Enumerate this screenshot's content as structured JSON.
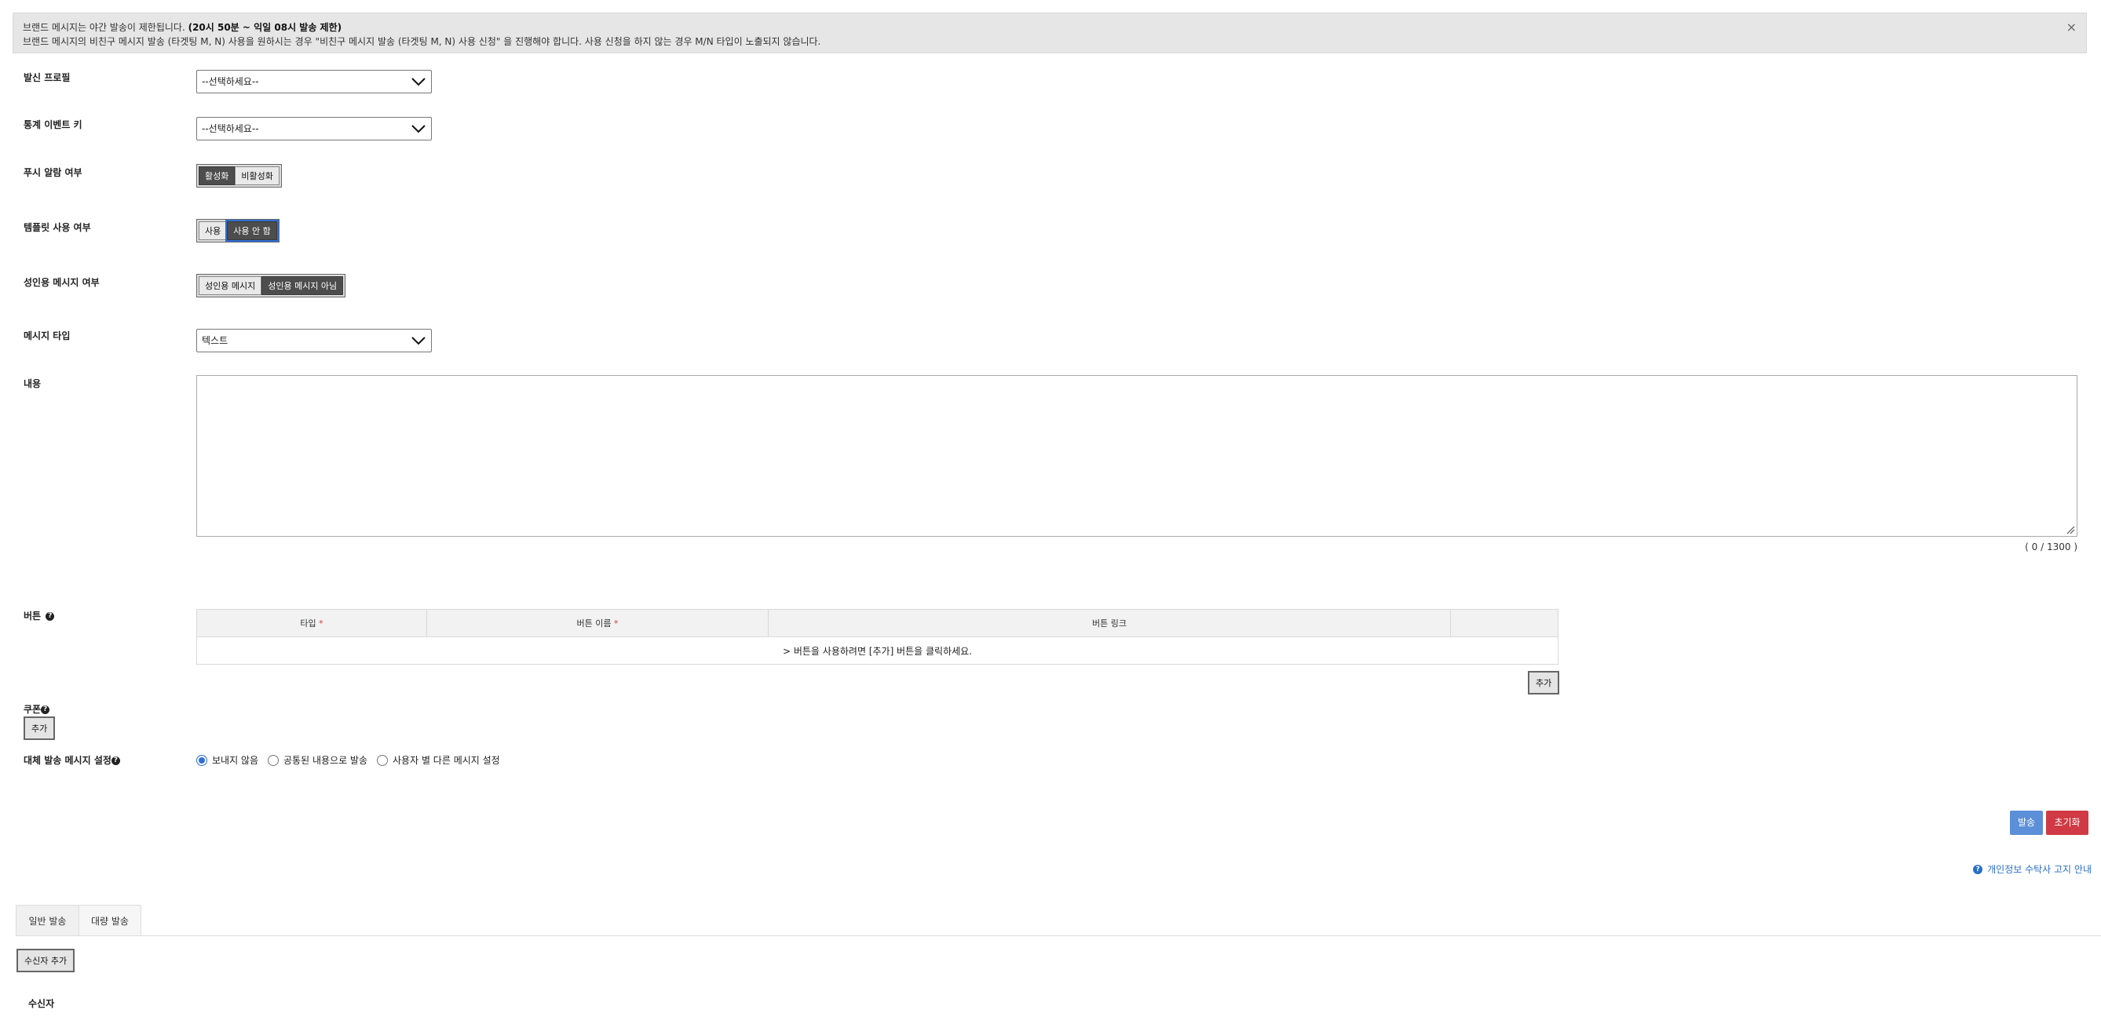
{
  "notice": {
    "line1_prefix": "브랜드 메시지는 야간 발송이 제한됩니다. ",
    "line1_bold": "(20시 50분 ~ 익일 08시 발송 제한)",
    "line2": "브랜드 메시지의 비친구 메시지 발송 (타겟팅 M, N) 사용을 원하시는 경우 \"비친구 메시지 발송 (타겟팅 M, N) 사용 신청\" 을 진행해야 합니다. 사용 신청을 하지 않는 경우 M/N 타입이 노출되지 않습니다.",
    "close": "×"
  },
  "form": {
    "sender_profile": {
      "label": "발신 프로필",
      "value": "--선택하세요--"
    },
    "stat_event_key": {
      "label": "통계 이벤트 키",
      "value": "--선택하세요--"
    },
    "push_alarm": {
      "label": "푸시 알람 여부",
      "options": [
        "활성화",
        "비활성화"
      ],
      "selected": "활성화"
    },
    "template_use": {
      "label": "템플릿 사용 여부",
      "options": [
        "사용",
        "사용 안 함"
      ],
      "selected": "사용 안 함"
    },
    "adult_message": {
      "label": "성인용 메시지 여부",
      "options": [
        "성인용 메시지",
        "성인용 메시지 아님"
      ],
      "selected": "성인용 메시지 아님"
    },
    "message_type": {
      "label": "메시지 타입",
      "value": "텍스트"
    },
    "content": {
      "label": "내용",
      "value": "",
      "counter": "( 0 / 1300 )"
    },
    "buttons": {
      "label": "버튼",
      "columns": [
        "타입",
        "버튼 이름",
        "버튼 링크",
        ""
      ],
      "required_mark": "*",
      "empty_message": "> 버튼을 사용하려면 [추가] 버튼을 클릭하세요.",
      "add_label": "추가"
    },
    "coupon": {
      "label": "쿠폰",
      "add_label": "추가"
    },
    "fallback": {
      "label": "대체 발송 메시지 설정",
      "options": [
        "보내지 않음",
        "공통된 내용으로 발송",
        "사용자 별 다른 메시지 설정"
      ],
      "selected": "보내지 않음"
    }
  },
  "actions": {
    "send": "발송",
    "reset": "초기화"
  },
  "privacy_link": "개인정보 수탁사 고지 안내",
  "tabs": [
    "일반 발송",
    "대량 발송"
  ],
  "recipient": {
    "add_label": "수신자 추가",
    "label": "수신자"
  },
  "colors": {
    "send": "#5b8fd8",
    "reset": "#cf3a44",
    "link": "#2a6fc9",
    "active_segment": "#4d4d4d"
  }
}
